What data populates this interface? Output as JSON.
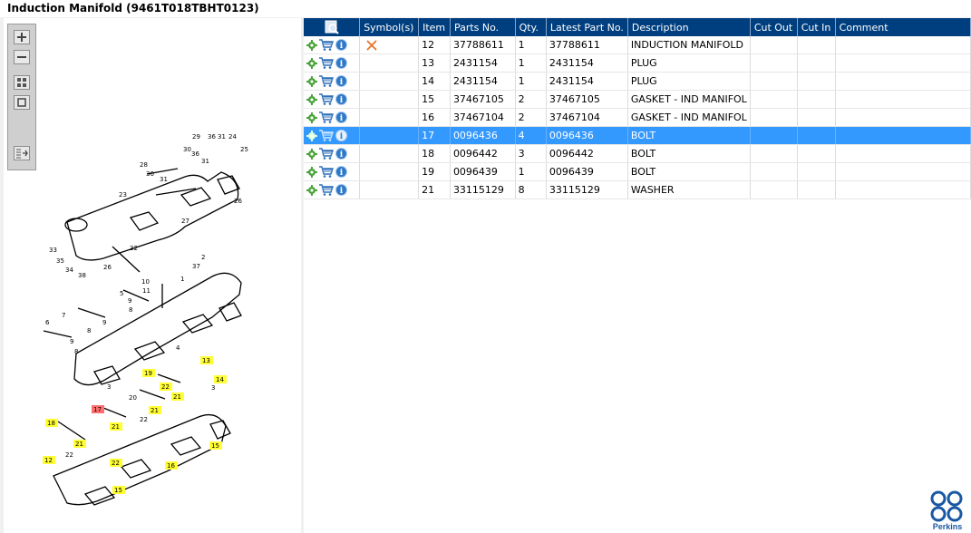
{
  "window": {
    "title": "Induction Manifold (9461T018TBHT0123)"
  },
  "columns": [
    "Symbol(s)",
    "Item",
    "Parts No.",
    "Qty.",
    "Latest Part No.",
    "Description",
    "Cut Out",
    "Cut In",
    "Comment"
  ],
  "rows": [
    {
      "item": "12",
      "parts_no": "37788611",
      "qty": "1",
      "latest": "37788611",
      "desc": "INDUCTION MANIFOLD",
      "symbol": "x-mark-icon",
      "selected": false
    },
    {
      "item": "13",
      "parts_no": "2431154",
      "qty": "1",
      "latest": "2431154",
      "desc": "PLUG",
      "symbol": "",
      "selected": false
    },
    {
      "item": "14",
      "parts_no": "2431154",
      "qty": "1",
      "latest": "2431154",
      "desc": "PLUG",
      "symbol": "",
      "selected": false
    },
    {
      "item": "15",
      "parts_no": "37467105",
      "qty": "2",
      "latest": "37467105",
      "desc": "GASKET - IND MANIFOL",
      "symbol": "",
      "selected": false
    },
    {
      "item": "16",
      "parts_no": "37467104",
      "qty": "2",
      "latest": "37467104",
      "desc": "GASKET - IND MANIFOL",
      "symbol": "",
      "selected": false
    },
    {
      "item": "17",
      "parts_no": "0096436",
      "qty": "4",
      "latest": "0096436",
      "desc": "BOLT",
      "symbol": "",
      "selected": true
    },
    {
      "item": "18",
      "parts_no": "0096442",
      "qty": "3",
      "latest": "0096442",
      "desc": "BOLT",
      "symbol": "",
      "selected": false
    },
    {
      "item": "19",
      "parts_no": "0096439",
      "qty": "1",
      "latest": "0096439",
      "desc": "BOLT",
      "symbol": "",
      "selected": false
    },
    {
      "item": "21",
      "parts_no": "33115129",
      "qty": "8",
      "latest": "33115129",
      "desc": "WASHER",
      "symbol": "",
      "selected": false
    }
  ],
  "diagram": {
    "callouts_plain": [
      "29",
      "36",
      "31",
      "24",
      "30",
      "36",
      "31",
      "25",
      "28",
      "36",
      "31",
      "26",
      "23",
      "27",
      "33",
      "35",
      "34",
      "38",
      "26",
      "32",
      "2",
      "37",
      "10",
      "11",
      "1",
      "5",
      "9",
      "8",
      "7",
      "9",
      "8",
      "6",
      "9",
      "8",
      "4",
      "3",
      "20",
      "22",
      "22",
      "3"
    ],
    "callouts_yellow": [
      "13",
      "19",
      "22",
      "14",
      "21",
      "21",
      "21",
      "18",
      "21",
      "22",
      "12",
      "16",
      "15",
      "15"
    ],
    "callouts_red": [
      "17"
    ]
  },
  "brand": {
    "logo_text": "Perkins"
  },
  "colors": {
    "header_bg": "#003f7f",
    "selected_row": "#3399ff",
    "callout_yellow": "#ffff33",
    "callout_red": "#ff6f6f"
  }
}
